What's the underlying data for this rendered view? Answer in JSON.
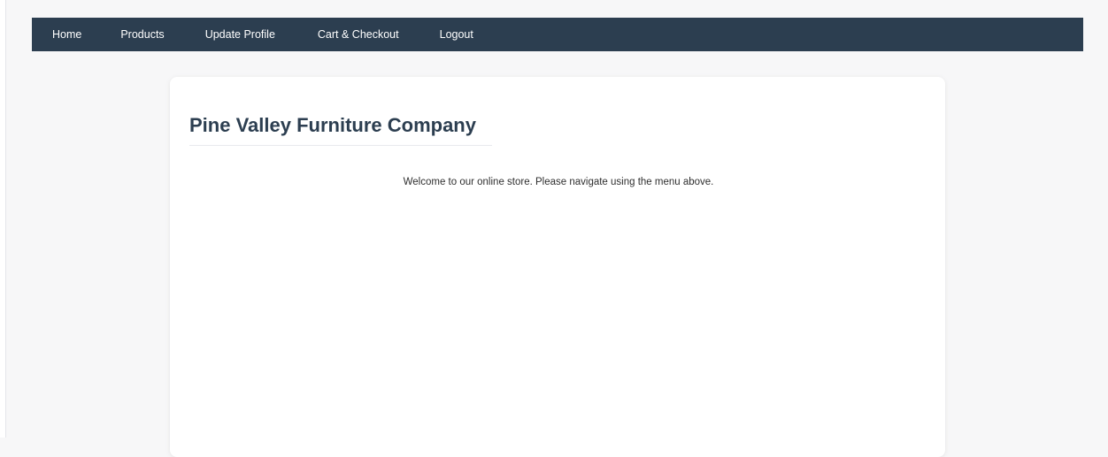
{
  "nav": {
    "items": [
      {
        "label": "Home"
      },
      {
        "label": "Products"
      },
      {
        "label": "Update Profile"
      },
      {
        "label": "Cart & Checkout"
      },
      {
        "label": "Logout"
      }
    ]
  },
  "main": {
    "title": "Pine Valley Furniture Company",
    "welcome": "Welcome to our online store. Please navigate using the menu above."
  },
  "colors": {
    "navbar_bg": "#2c3e50",
    "title": "#2c3e50",
    "page_bg": "#f7f7f8",
    "card_bg": "#ffffff"
  }
}
